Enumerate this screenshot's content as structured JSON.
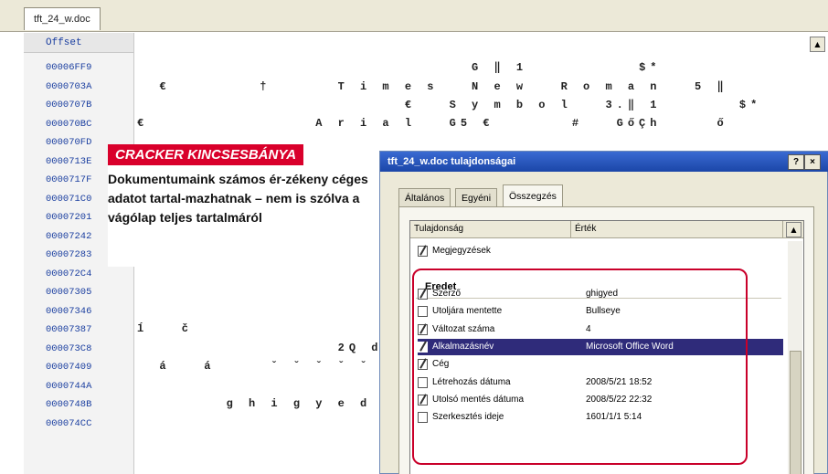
{
  "file_tab": "tft_24_w.doc",
  "hex_header": "Offset",
  "offsets": [
    "00006FF9",
    "0000703A",
    "0000707B",
    "000070BC",
    "000070FD",
    "0000713E",
    "0000717F",
    "000071C0",
    "00007201",
    "00007242",
    "00007283",
    "000072C4",
    "00007305",
    "00007346",
    "00007387",
    "000073C8",
    "00007409",
    "0000744A",
    "0000748B",
    "000074CC"
  ],
  "hex_lines": [
    "                              G ‖ 1          $*",
    "  €        †      T i m e s   N e w   R o m a n   5 ‖",
    "                        €   S y m b o l   3.‖ 1       $*",
    "€               A r i a l   G5 €       #   GőÇh     ő",
    "",
    "",
    "",
    "",
    "",
    "",
    "",
    "",
    "",
    "",
    "ĺ   č",
    "                  2Q d   úý",
    "  á   á     ˇ ˇ ˇ ˇ ˇ ˇ ˇ ˇ",
    "",
    "        g h i g y e d   B",
    ""
  ],
  "caption": {
    "title": "CRACKER KINCSESBÁNYA",
    "text": "Dokumentumaink számos ér-zékeny céges adatot tartal-mazhatnak – nem is szólva a vágólap teljes tartalmáról"
  },
  "dialog": {
    "title": "tft_24_w.doc tulajdonságai",
    "help_btn": "?",
    "close_btn": "×",
    "tabs": [
      "Általános",
      "Egyéni",
      "Összegzés"
    ],
    "active_tab": "Összegzés",
    "columns": [
      "Tulajdonság",
      "Érték"
    ],
    "top_item": "Megjegyzések",
    "group": "Eredet",
    "rows": [
      {
        "name": "Szerző",
        "value": "ghigyed",
        "icon": "edit"
      },
      {
        "name": "Utoljára mentette",
        "value": "Bullseye",
        "icon": "doc"
      },
      {
        "name": "Változat száma",
        "value": "4",
        "icon": "edit"
      },
      {
        "name": "Alkalmazásnév",
        "value": "Microsoft Office Word",
        "icon": "edit",
        "selected": true
      },
      {
        "name": "Cég",
        "value": "",
        "icon": "edit"
      },
      {
        "name": "Létrehozás dátuma",
        "value": "2008/5/21 18:52",
        "icon": "doc"
      },
      {
        "name": "Utolsó mentés dátuma",
        "value": "2008/5/22 22:32",
        "icon": "edit"
      },
      {
        "name": "Szerkesztés ideje",
        "value": "1601/1/1 5:14",
        "icon": "doc"
      }
    ]
  },
  "colors": {
    "caption_red": "#d9002b",
    "highlight_red": "#c9002a",
    "selection": "#2f2b7a",
    "offset_blue": "#1b3fa0"
  }
}
